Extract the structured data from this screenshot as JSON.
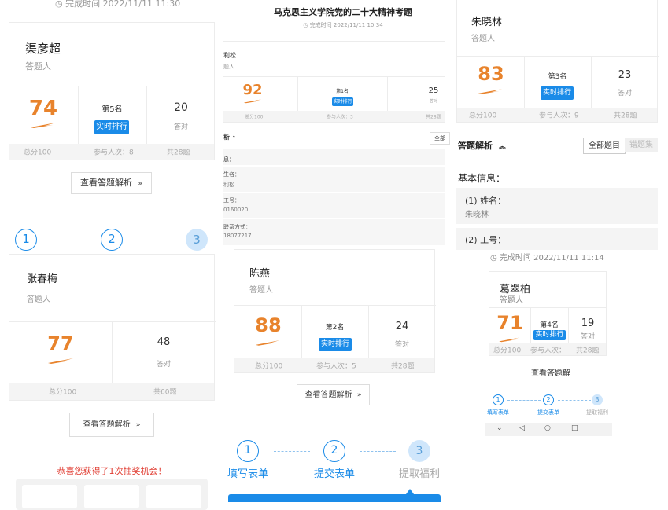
{
  "panel_a": {
    "timestamp": "完成时间 2022/11/11 11:30",
    "name": "渠彦超",
    "role": "答题人",
    "score": "74",
    "rank": "第5名",
    "rank_button": "实时排行",
    "correct": "20",
    "correct_label": "答对",
    "total_score": "总分100",
    "participants": "参与人次：8",
    "total_questions": "共28题",
    "analysis_button": "查看答题解析",
    "steps": [
      "1",
      "2",
      "3"
    ]
  },
  "panel_b": {
    "name": "张春梅",
    "role": "答题人",
    "score": "77",
    "correct": "48",
    "correct_label": "答对",
    "total_score": "总分100",
    "total_questions": "共60题",
    "analysis_button": "查看答题解析",
    "prize_text": "恭喜您获得了1次抽奖机会！"
  },
  "panel_c": {
    "title": "马克思主义学院党的二十大精神考题",
    "timestamp": "完成时间 2022/11/11 10:34",
    "name_partial": "利松",
    "role_partial": "题人",
    "score": "92",
    "rank": "第1名",
    "rank_button": "实时排行",
    "correct": "25",
    "correct_label": "答对",
    "total_score": "总分100",
    "participants": "参与人次：3",
    "total_questions": "共28题",
    "section": "析",
    "all_button": "全部",
    "info_rows": [
      "息：",
      "生名：",
      "利松",
      "工号：",
      "0160020",
      "联系方式：",
      "18077217"
    ]
  },
  "panel_d": {
    "name": "陈燕",
    "role": "答题人",
    "score": "88",
    "rank": "第2名",
    "rank_button": "实时排行",
    "correct": "24",
    "correct_label": "答对",
    "total_score": "总分100",
    "participants": "参与人次：5",
    "total_questions": "共28题",
    "analysis_button": "查看答题解析",
    "steps": [
      {
        "num": "1",
        "label": "填写表单"
      },
      {
        "num": "2",
        "label": "提交表单"
      },
      {
        "num": "3",
        "label": "提取福利"
      }
    ]
  },
  "panel_e": {
    "name": "朱晓林",
    "role": "答题人",
    "score": "83",
    "rank": "第3名",
    "rank_button": "实时排行",
    "correct": "23",
    "correct_label": "答对",
    "total_score": "总分100",
    "participants": "参与人次：9",
    "total_questions": "共28题",
    "section": "答题解析",
    "tab_all": "全部题目",
    "tab_wrong": "错题集",
    "basic_info": "基本信息：",
    "q1": "(1) 姓名：",
    "a1": "朱晓林",
    "q2": "(2) 工号："
  },
  "panel_f": {
    "timestamp": "完成时间 2022/11/11 11:14",
    "name": "葛翠柏",
    "role": "答题人",
    "score": "71",
    "rank": "第4名",
    "rank_button": "实时排行",
    "correct": "19",
    "correct_label": "答对",
    "total_score": "总分100",
    "participants": "参与人次：",
    "total_questions": "共28题",
    "analysis_button": "查看答题解",
    "steps": [
      {
        "num": "1",
        "label": "填写表单"
      },
      {
        "num": "2",
        "label": "提交表单"
      },
      {
        "num": "3",
        "label": "提取福利"
      }
    ],
    "nav": [
      "chevron-down",
      "back",
      "home",
      "recents"
    ]
  },
  "colors": {
    "accent": "#1a8be8",
    "score": "#e8832c",
    "prize": "#e03a2f"
  }
}
